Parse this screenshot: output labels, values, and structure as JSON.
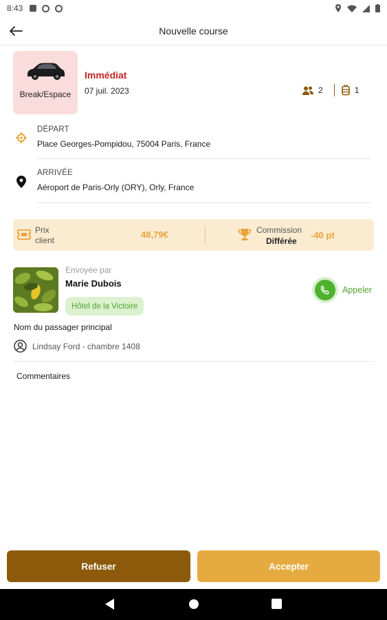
{
  "status_bar": {
    "time": "8:43"
  },
  "app_bar": {
    "title": "Nouvelle course"
  },
  "vehicle": {
    "label": "Break/Espace"
  },
  "ride": {
    "type": "Immédiat",
    "date": "07 juil. 2023",
    "passengers": "2",
    "luggage": "1"
  },
  "departure": {
    "label": "DÉPART",
    "address": "Place Georges-Pompidou, 75004 Paris, France"
  },
  "arrival": {
    "label": "ARRIVÉE",
    "address": "Aéroport de Paris-Orly (ORY), Orly, France"
  },
  "pricing": {
    "price_label_line1": "Prix",
    "price_label_line2": "client",
    "price_value": "48,79€",
    "commission_label": "Commission",
    "commission_mode": "Différée",
    "commission_value": "-40 pt"
  },
  "sender": {
    "sent_by_label": "Envoyée par",
    "name": "Marie Dubois",
    "hotel": "Hôtel de la Victoire",
    "call_label": "Appeler"
  },
  "passenger": {
    "title": "Nom du passager principal",
    "name": "Lindsay Ford - chambre 1408"
  },
  "comments": {
    "label": "Commentaires"
  },
  "actions": {
    "refuse_label": "Refuser",
    "accept_label": "Accepter"
  },
  "colors": {
    "brand_dark": "#8c5a0a",
    "brand_light": "#e6ab40",
    "accent_red": "#c42525",
    "call_green": "#4fb22c"
  },
  "icons": {
    "back": "arrow-left-icon",
    "vehicle": "car-icon",
    "passengers": "people-icon",
    "luggage": "suitcase-icon",
    "departure": "location-target-icon",
    "arrival": "map-pin-icon",
    "price": "ticket-icon",
    "commission": "trophy-icon",
    "call": "phone-icon",
    "passenger": "user-circle-icon"
  }
}
